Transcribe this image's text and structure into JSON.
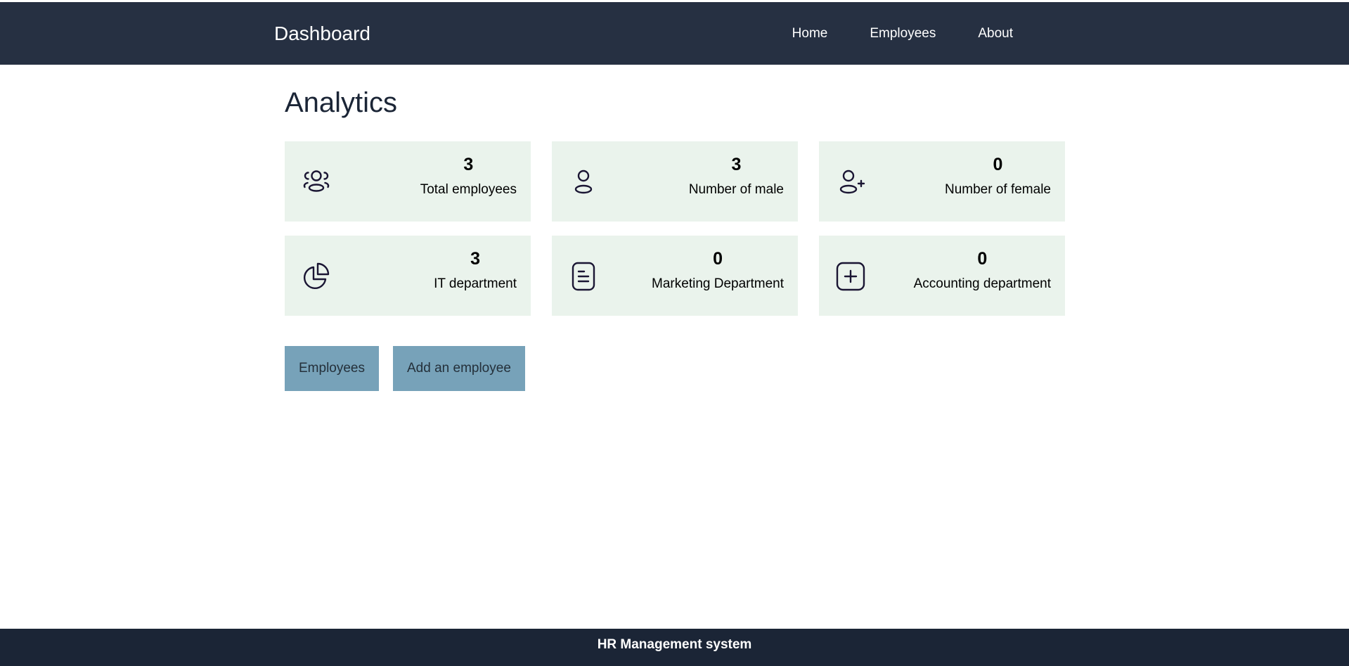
{
  "header": {
    "brand": "Dashboard",
    "nav": [
      {
        "label": "Home"
      },
      {
        "label": "Employees"
      },
      {
        "label": "About"
      }
    ]
  },
  "main": {
    "title": "Analytics",
    "cards": [
      {
        "value": "3",
        "label": "Total employees",
        "icon": "users-icon"
      },
      {
        "value": "3",
        "label": "Number of male",
        "icon": "user-icon"
      },
      {
        "value": "0",
        "label": "Number of female",
        "icon": "user-plus-icon"
      },
      {
        "value": "3",
        "label": "IT department",
        "icon": "pie-chart-icon"
      },
      {
        "value": "0",
        "label": "Marketing Department",
        "icon": "file-text-icon"
      },
      {
        "value": "0",
        "label": "Accounting department",
        "icon": "plus-square-icon"
      }
    ],
    "buttons": {
      "employees": "Employees",
      "add_employee": "Add an employee"
    }
  },
  "footer": {
    "text": "HR Management system"
  },
  "colors": {
    "navbar": "#263042",
    "footer": "#1b2536",
    "card_background": "#eaf3ec",
    "button": "#77a2b9",
    "icon_stroke": "#1a1533"
  }
}
